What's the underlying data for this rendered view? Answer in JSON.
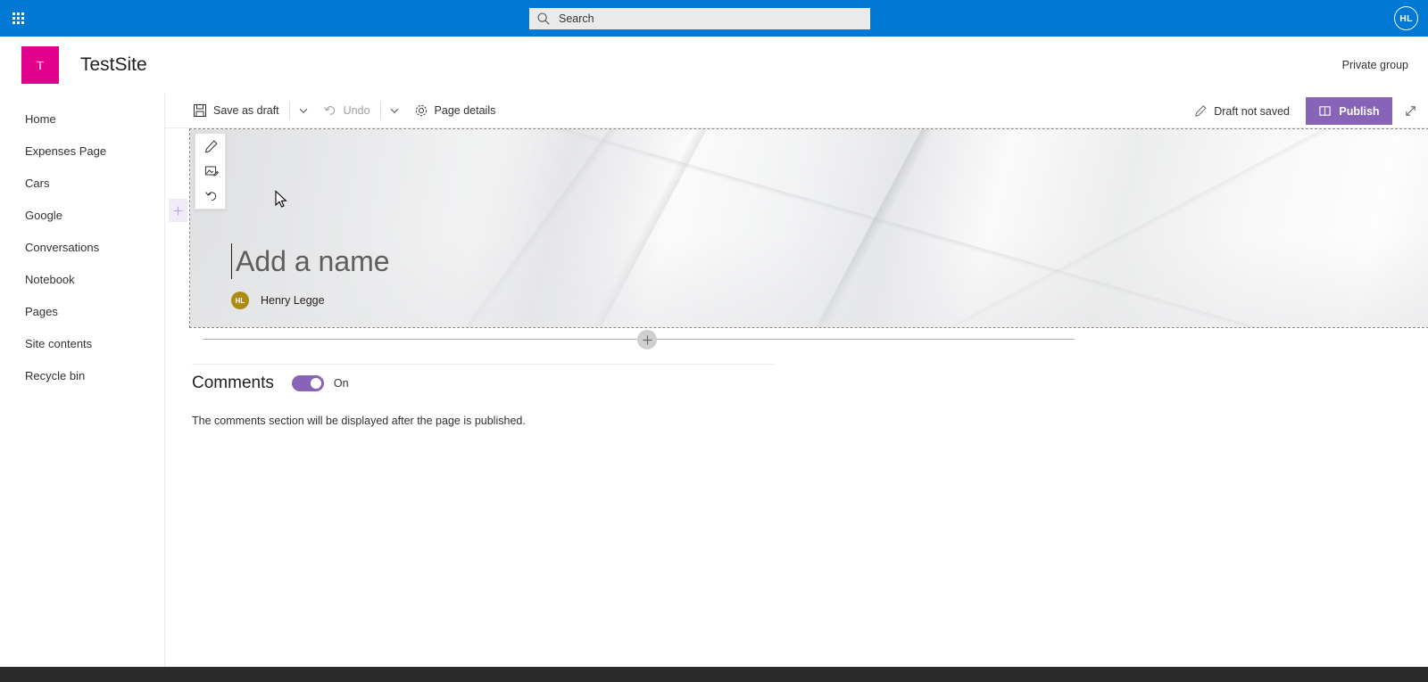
{
  "suite": {
    "waffle_icon": "app-launcher-icon",
    "search": {
      "placeholder": "Search",
      "value": "",
      "icon": "search-icon"
    },
    "avatar_initials": "HL"
  },
  "site_header": {
    "logo_letter": "T",
    "logo_color": "#e3008c",
    "title": "TestSite",
    "group_privacy": "Private group"
  },
  "sidebar": {
    "items": [
      {
        "label": "Home"
      },
      {
        "label": "Expenses Page"
      },
      {
        "label": "Cars"
      },
      {
        "label": "Google"
      },
      {
        "label": "Conversations"
      },
      {
        "label": "Notebook"
      },
      {
        "label": "Pages"
      },
      {
        "label": "Site contents"
      },
      {
        "label": "Recycle bin"
      }
    ]
  },
  "command_bar": {
    "save_as_draft": {
      "label": "Save as draft",
      "icon": "save-icon"
    },
    "save_chevron": {
      "icon": "chevron-down-icon"
    },
    "undo": {
      "label": "Undo",
      "icon": "undo-icon",
      "disabled": true
    },
    "undo_chevron": {
      "icon": "chevron-down-icon"
    },
    "page_details": {
      "label": "Page details",
      "icon": "gear-icon"
    },
    "draft_status": {
      "label": "Draft not saved",
      "icon": "pencil-icon"
    },
    "publish": {
      "label": "Publish",
      "icon": "publish-icon",
      "color": "#8764b8"
    },
    "expand": {
      "icon": "expand-diagonal-icon"
    }
  },
  "hero": {
    "toolbar": [
      {
        "icon": "pencil-icon",
        "name": "edit-title-region"
      },
      {
        "icon": "change-image-icon",
        "name": "change-image"
      },
      {
        "icon": "undo-icon",
        "name": "reset-hero"
      }
    ],
    "title_placeholder": "Add a name",
    "author": {
      "initials": "HL",
      "name": "Henry Legge",
      "avatar_color": "#ac8b15"
    }
  },
  "canvas": {
    "edge_add_section": {
      "icon": "plus-icon"
    },
    "add_section": {
      "icon": "plus-icon"
    }
  },
  "comments": {
    "title": "Comments",
    "toggle_state": "On",
    "toggle_color": "#8764b8",
    "note": "The comments section will be displayed after the page is published."
  }
}
